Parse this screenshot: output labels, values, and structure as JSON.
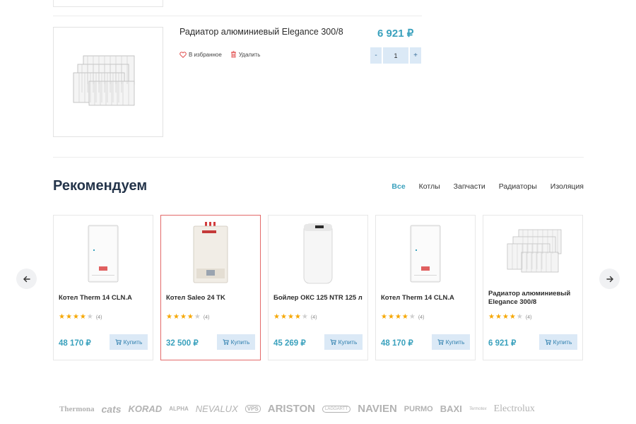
{
  "cart_item": {
    "title": "Радиатор алюминиевый Elegance 300/8",
    "price": "6 921 ₽",
    "favorite_label": "В избранное",
    "delete_label": "Удалить",
    "qty_minus": "-",
    "qty_value": "1",
    "qty_plus": "+"
  },
  "section": {
    "title": "Рекомендуем",
    "filters": [
      "Все",
      "Котлы",
      "Запчасти",
      "Радиаторы",
      "Изоляция"
    ]
  },
  "products": [
    {
      "name": "Котел Therm 14 CLN.A",
      "rating_count": "(4)",
      "price": "48 170 ₽",
      "buy_label": "Купить"
    },
    {
      "name": "Котел Saleo 24 TK",
      "rating_count": "(4)",
      "price": "32 500 ₽",
      "buy_label": "Купить"
    },
    {
      "name": "Бойлер ОКС 125 NTR 125 л",
      "rating_count": "(4)",
      "price": "45 269 ₽",
      "buy_label": "Купить"
    },
    {
      "name": "Котел Therm 14 CLN.A",
      "rating_count": "(4)",
      "price": "48 170 ₽",
      "buy_label": "Купить"
    },
    {
      "name": "Радиатор алюминиевый Elegance 300/8",
      "rating_count": "(4)",
      "price": "6 921 ₽",
      "buy_label": "Купить"
    }
  ],
  "ratings": [
    4,
    4,
    4,
    4,
    4
  ],
  "brands": [
    "Thermona",
    "cats",
    "KORAD",
    "ALPHA",
    "NEVALUX",
    "VPS",
    "ARISTON",
    "LAGGARTT",
    "NAVIEN",
    "PURMO",
    "BAXI",
    "Termotex",
    "Electrolux"
  ],
  "colors": {
    "accent": "#3aa1bd",
    "button_bg": "#dbe9f6",
    "star": "#f6a700",
    "highlight_border": "#e36a6a",
    "heading": "#24344a"
  }
}
